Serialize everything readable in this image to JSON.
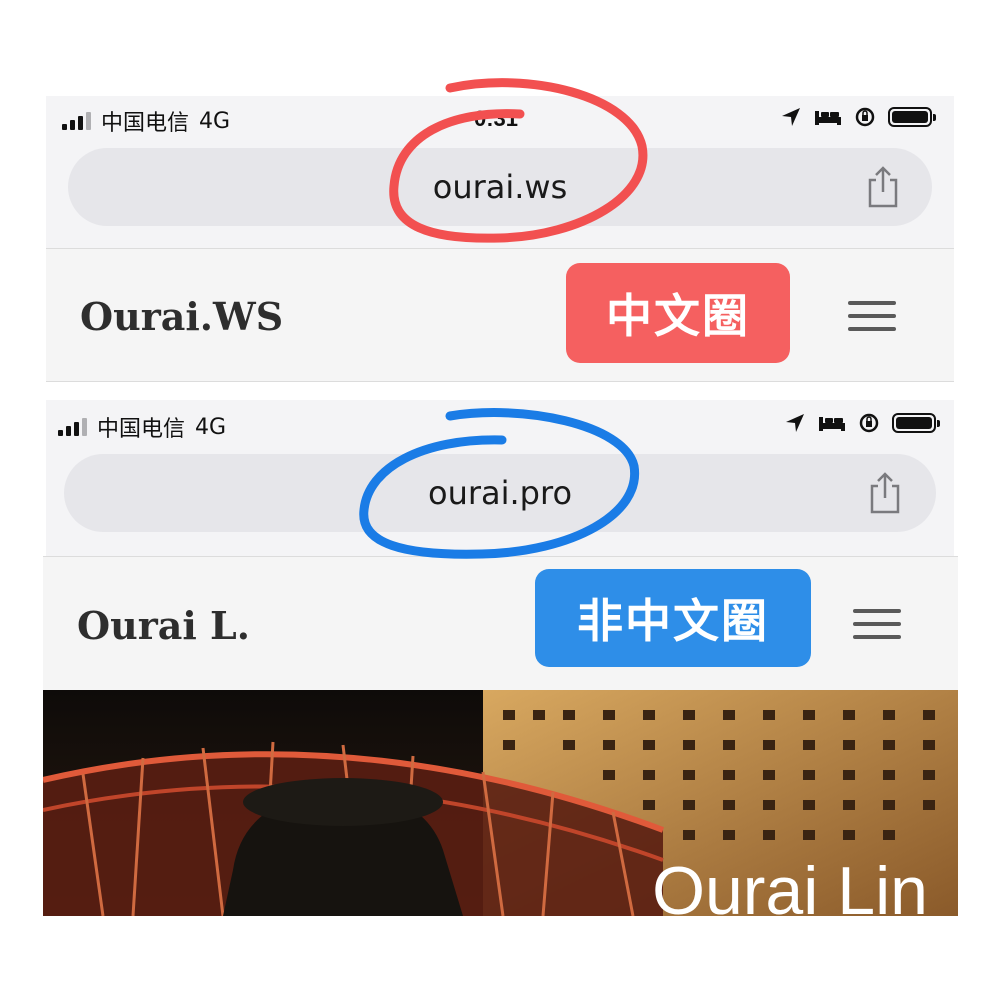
{
  "colors": {
    "ws_badge": "#f56060",
    "pro_badge": "#2e8ee8",
    "ws_circle": "#f25050",
    "pro_circle": "#1a7ce6"
  },
  "top_screen": {
    "carrier": "中国电信",
    "network": "4G",
    "time": "0:31",
    "url": "ourai.ws",
    "site_title": "Ourai.WS",
    "badge": "中文圈",
    "icons": [
      "location-arrow-icon",
      "bed-icon",
      "rotation-lock-icon",
      "battery-icon",
      "share-icon",
      "hamburger-menu-icon"
    ]
  },
  "bottom_screen": {
    "carrier": "中国电信",
    "network": "4G",
    "url": "ourai.pro",
    "site_title": "Ourai L.",
    "badge": "非中文圈",
    "hero_title": "Ourai Lin",
    "icons": [
      "location-arrow-icon",
      "bed-icon",
      "rotation-lock-icon",
      "battery-icon",
      "share-icon",
      "hamburger-menu-icon"
    ]
  }
}
